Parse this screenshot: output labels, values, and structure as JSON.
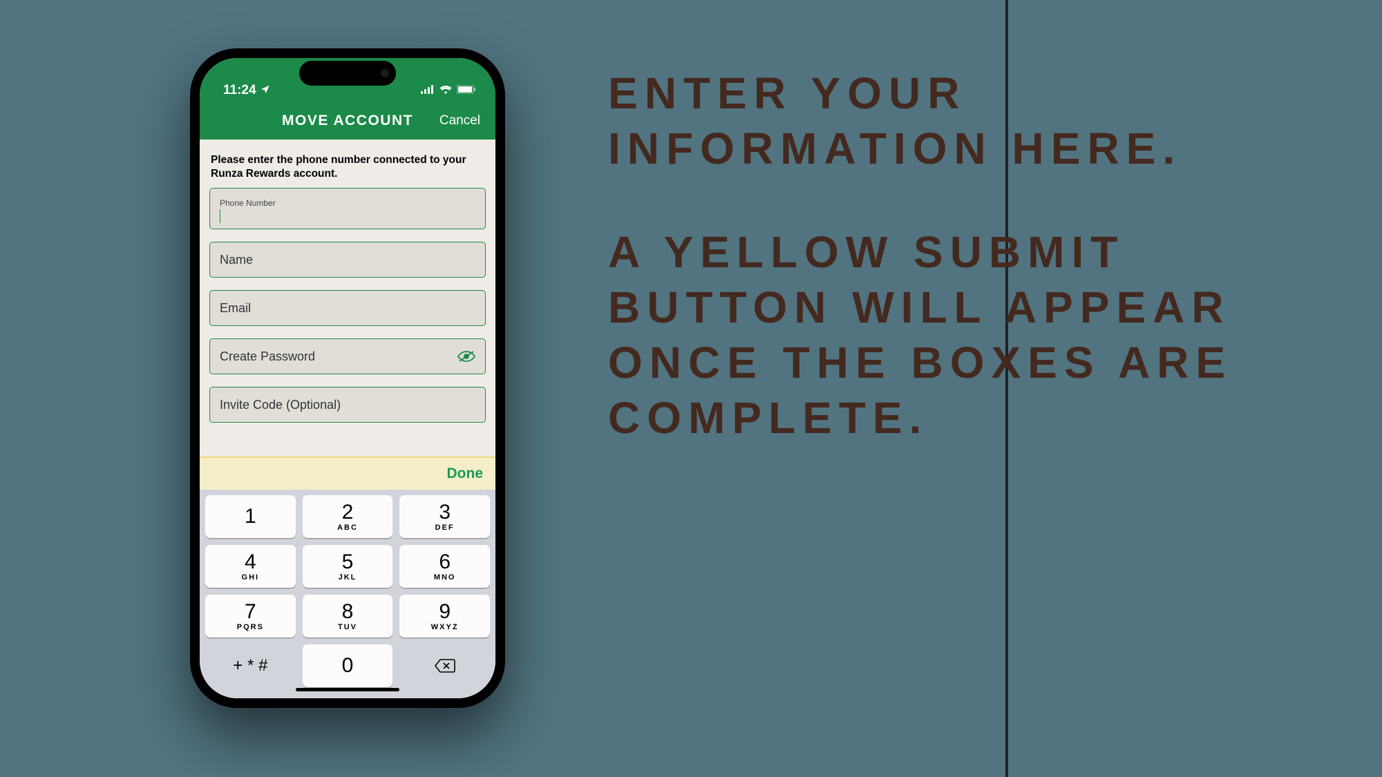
{
  "instructions": {
    "line1": "ENTER YOUR INFORMATION HERE.",
    "line2": "A YELLOW SUBMIT BUTTON WILL APPEAR ONCE THE BOXES ARE COMPLETE."
  },
  "statusbar": {
    "time": "11:24"
  },
  "header": {
    "title": "MOVE ACCOUNT",
    "cancel": "Cancel"
  },
  "form": {
    "prompt": "Please enter the phone number connected to your Runza Rewards account.",
    "fields": {
      "phone": "Phone Number",
      "name": "Name",
      "email": "Email",
      "password": "Create Password",
      "invite": "Invite Code (Optional)"
    }
  },
  "keyboard": {
    "done": "Done",
    "keys": [
      {
        "num": "1",
        "sub": ""
      },
      {
        "num": "2",
        "sub": "ABC"
      },
      {
        "num": "3",
        "sub": "DEF"
      },
      {
        "num": "4",
        "sub": "GHI"
      },
      {
        "num": "5",
        "sub": "JKL"
      },
      {
        "num": "6",
        "sub": "MNO"
      },
      {
        "num": "7",
        "sub": "PQRS"
      },
      {
        "num": "8",
        "sub": "TUV"
      },
      {
        "num": "9",
        "sub": "WXYZ"
      }
    ],
    "symbols": "+ * #",
    "zero": "0"
  }
}
